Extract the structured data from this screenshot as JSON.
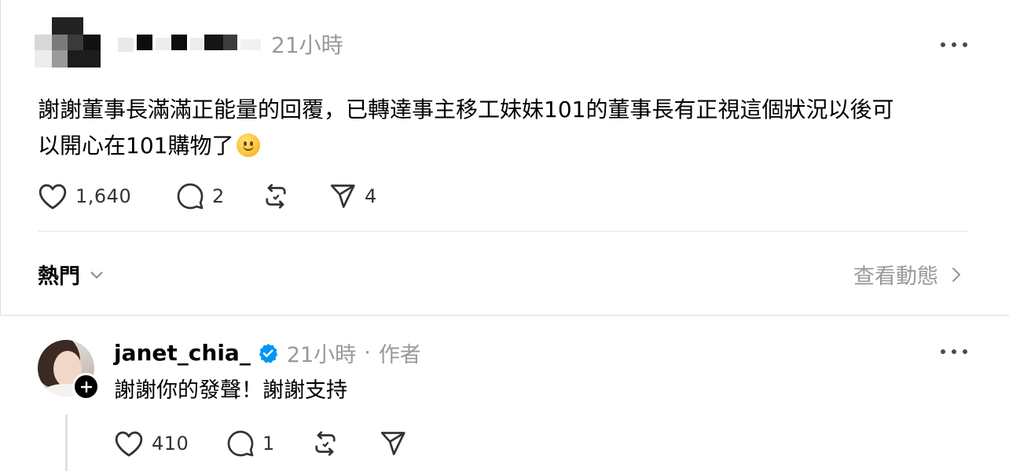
{
  "post": {
    "time": "21小時",
    "text_line1": "謝謝董事長滿滿正能量的回覆，已轉達事主移工妹妹101的董事長有正視這個狀況以後可",
    "text_line2": "以開心在101購物了",
    "emoji": "slightly-smiling-face",
    "actions": {
      "like_count": "1,640",
      "comment_count": "2",
      "repost_count": "",
      "share_count": "4"
    }
  },
  "sort_bar": {
    "sort_label": "熱門",
    "activity_label": "查看動態"
  },
  "reply": {
    "username": "janet_chia_",
    "verified": true,
    "time": "21小時",
    "separator": "·",
    "author_label": "作者",
    "text": "謝謝你的發聲！謝謝支持",
    "actions": {
      "like_count": "410",
      "comment_count": "1"
    }
  },
  "icons": {
    "like": "heart-icon",
    "comment": "comment-bubble-icon",
    "repost": "repost-icon",
    "share": "send-icon",
    "more": "more-horizontal-icon",
    "chevron_down": "chevron-down-icon",
    "chevron_right": "chevron-right-icon",
    "verified": "verified-badge-icon",
    "follow": "plus-icon"
  },
  "colors": {
    "text": "#000000",
    "muted": "#999999",
    "icon": "#333333",
    "verified_blue": "#0095f6",
    "divider": "#e3e3e3"
  }
}
